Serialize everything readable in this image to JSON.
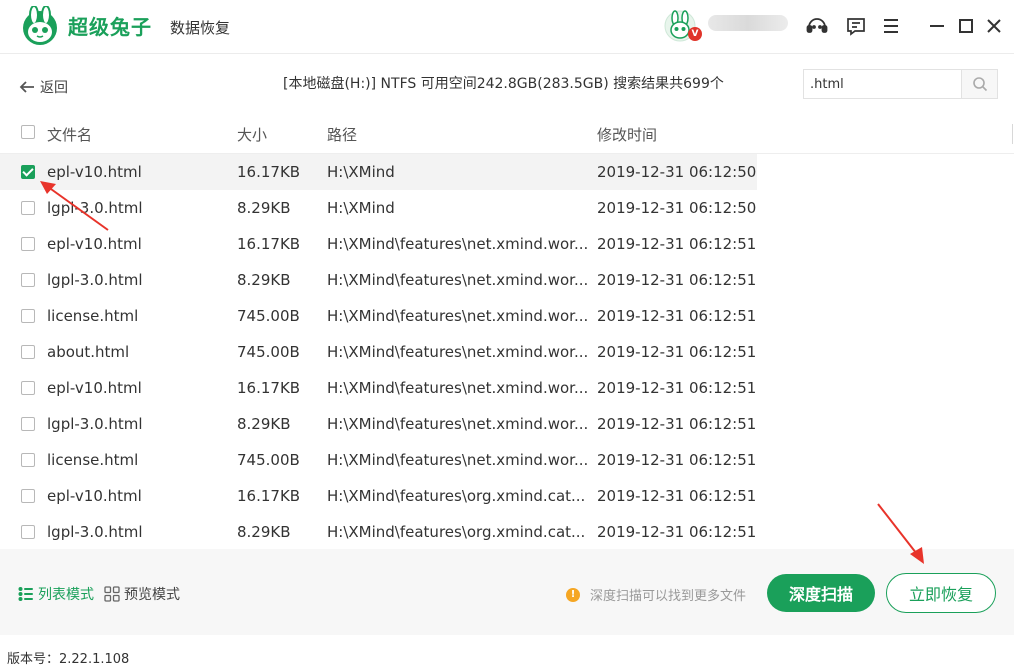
{
  "app": {
    "brand": "超级兔子",
    "subtitle": "数据恢复",
    "vip_badge": "V"
  },
  "header": {
    "back_label": "返回",
    "scan_info": "[本地磁盘(H:)] NTFS 可用空间242.8GB(283.5GB) 搜索结果共699个",
    "search_value": ".html"
  },
  "table": {
    "columns": [
      "文件名",
      "大小",
      "路径",
      "修改时间"
    ],
    "rows": [
      {
        "checked": true,
        "name": "epl-v10.html",
        "size": "16.17KB",
        "path": "H:\\XMind",
        "time": "2019-12-31 06:12:50"
      },
      {
        "checked": false,
        "name": "lgpl-3.0.html",
        "size": "8.29KB",
        "path": "H:\\XMind",
        "time": "2019-12-31 06:12:50"
      },
      {
        "checked": false,
        "name": "epl-v10.html",
        "size": "16.17KB",
        "path": "H:\\XMind\\features\\net.xmind.wor...",
        "time": "2019-12-31 06:12:51"
      },
      {
        "checked": false,
        "name": "lgpl-3.0.html",
        "size": "8.29KB",
        "path": "H:\\XMind\\features\\net.xmind.wor...",
        "time": "2019-12-31 06:12:51"
      },
      {
        "checked": false,
        "name": "license.html",
        "size": "745.00B",
        "path": "H:\\XMind\\features\\net.xmind.wor...",
        "time": "2019-12-31 06:12:51"
      },
      {
        "checked": false,
        "name": "about.html",
        "size": "745.00B",
        "path": "H:\\XMind\\features\\net.xmind.wor...",
        "time": "2019-12-31 06:12:51"
      },
      {
        "checked": false,
        "name": "epl-v10.html",
        "size": "16.17KB",
        "path": "H:\\XMind\\features\\net.xmind.wor...",
        "time": "2019-12-31 06:12:51"
      },
      {
        "checked": false,
        "name": "lgpl-3.0.html",
        "size": "8.29KB",
        "path": "H:\\XMind\\features\\net.xmind.wor...",
        "time": "2019-12-31 06:12:51"
      },
      {
        "checked": false,
        "name": "license.html",
        "size": "745.00B",
        "path": "H:\\XMind\\features\\net.xmind.wor...",
        "time": "2019-12-31 06:12:51"
      },
      {
        "checked": false,
        "name": "epl-v10.html",
        "size": "16.17KB",
        "path": "H:\\XMind\\features\\org.xmind.cat...",
        "time": "2019-12-31 06:12:51"
      },
      {
        "checked": false,
        "name": "lgpl-3.0.html",
        "size": "8.29KB",
        "path": "H:\\XMind\\features\\org.xmind.cat...",
        "time": "2019-12-31 06:12:51"
      }
    ]
  },
  "footer": {
    "list_mode": "列表模式",
    "preview_mode": "预览模式",
    "hint": "深度扫描可以找到更多文件",
    "hint_icon": "!",
    "deep_scan": "深度扫描",
    "recover_now": "立即恢复",
    "version": "版本号：2.22.1.108"
  },
  "colors": {
    "accent": "#1aa05a",
    "annotation_arrow": "#e8332a",
    "warning": "#f5a623"
  }
}
